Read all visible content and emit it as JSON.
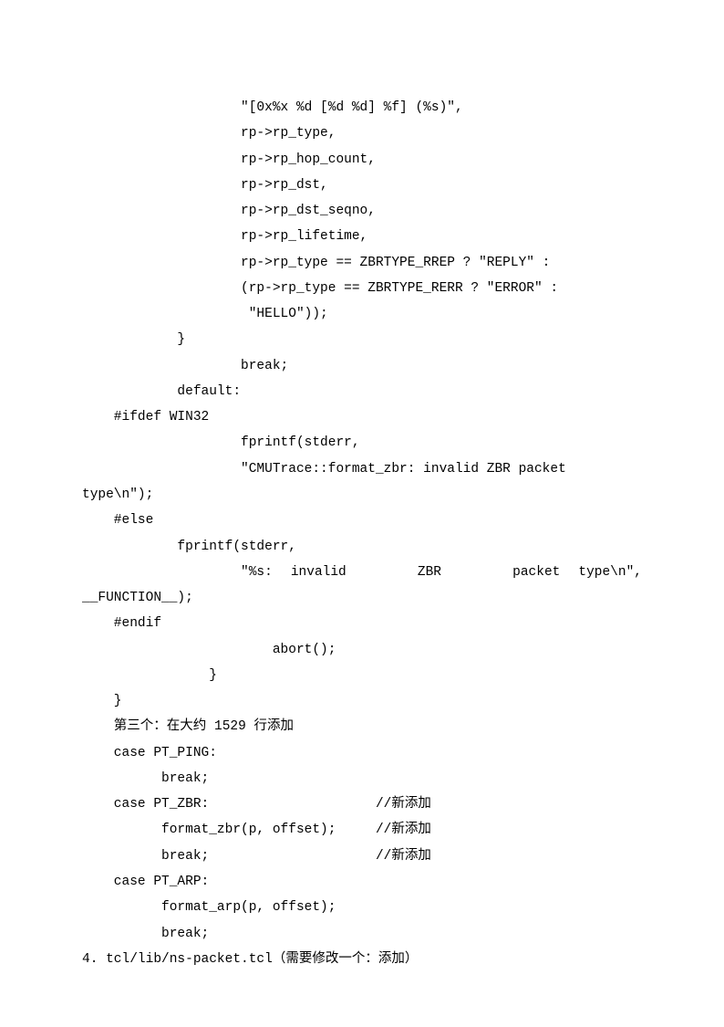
{
  "lines": [
    "                    \"[0x%x %d [%d %d] %f] (%s)\",",
    "                    rp->rp_type,",
    "                    rp->rp_hop_count,",
    "                    rp->rp_dst,",
    "                    rp->rp_dst_seqno,",
    "                    rp->rp_lifetime,",
    "                    rp->rp_type == ZBRTYPE_RREP ? \"REPLY\" :",
    "                    (rp->rp_type == ZBRTYPE_RERR ? \"ERROR\" :",
    "                     \"HELLO\"));",
    "            }",
    "                    break;",
    "            default:",
    "    #ifdef WIN32",
    "                    fprintf(stderr,",
    "                    \"CMUTrace::format_zbr: invalid ZBR packet ",
    "type\\n\");",
    "    #else",
    "            fprintf(stderr,"
  ],
  "justified": {
    "left": "                    \"%s:",
    "mid_parts": [
      "invalid",
      "ZBR",
      "packet"
    ],
    "right": "type\\n\","
  },
  "lines2": [
    "__FUNCTION__);",
    "    #endif",
    "                        abort();",
    "                }",
    "    }",
    "    第三个：在大约 1529 行添加",
    "    case PT_PING:",
    "          break;",
    "    case PT_ZBR:                     //新添加",
    "          format_zbr(p, offset);     //新添加",
    "          break;                     //新添加",
    "    case PT_ARP:",
    "          format_arp(p, offset);",
    "          break;",
    "4. tcl/lib/ns-packet.tcl（需要修改一个：添加）"
  ]
}
